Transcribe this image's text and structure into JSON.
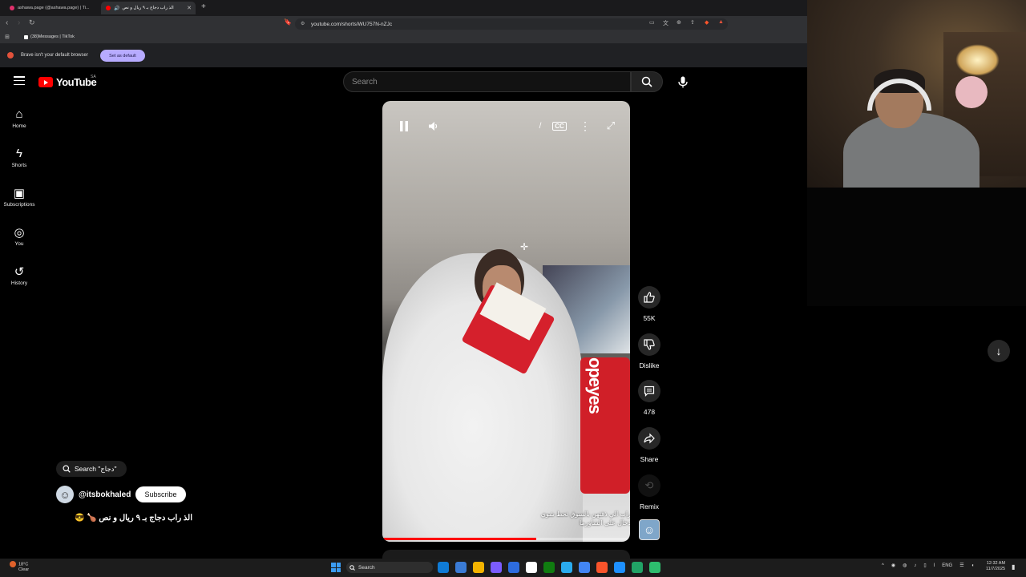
{
  "browser": {
    "tabs": [
      {
        "title": "ashawa.page (@ashawa.page) | Ti...",
        "active": false,
        "favicon_color": "#e1306c"
      },
      {
        "title": "الذ راب دجاج بـ ٩ ريال و نص",
        "active": true,
        "favicon_color": "#ff0000"
      }
    ],
    "new_tab_icon": "+",
    "url": "youtube.com/shorts/WU757N-nZJc",
    "bookmark": "(38)Messages | TikTok",
    "infobar": {
      "message": "Brave isn't your default browser",
      "button": "Set as default"
    }
  },
  "youtube": {
    "logo_text": "YouTube",
    "country": "SA",
    "search_placeholder": "Search",
    "sidebar": [
      {
        "label": "Home",
        "icon": "home-icon"
      },
      {
        "label": "Shorts",
        "icon": "shorts-icon"
      },
      {
        "label": "Subscriptions",
        "icon": "subscriptions-icon"
      },
      {
        "label": "You",
        "icon": "you-icon"
      },
      {
        "label": "History",
        "icon": "history-icon"
      }
    ],
    "video": {
      "caption_line1": "راب الي ذقتهن بالسوق تحط شوي",
      "caption_line2": "دخال على الشاورما",
      "cup_text": "opeyes",
      "progress": 0.62
    },
    "actions": {
      "like_count": "55K",
      "dislike_label": "Dislike",
      "comment_count": "478",
      "share_label": "Share",
      "remix_label": "Remix"
    },
    "search_chip": "Search \"دجاج\"",
    "channel": {
      "handle": "@itsbokhaled",
      "subscribe_label": "Subscribe"
    },
    "short_title": "الذ راب دجاج بـ ٩ ريال و نص 🍗 😎"
  },
  "taskbar": {
    "weather_temp": "18°C",
    "weather_desc": "Clear",
    "search_label": "Search",
    "language": "ENG",
    "time": "12:32 AM",
    "date": "11/7/2025",
    "app_colors": [
      "#0f7bd6",
      "#3a7bd5",
      "#f4b400",
      "#7b5cff",
      "#2d6cdf",
      "#ffffff",
      "#107c10",
      "#2aabee",
      "#4285f4",
      "#fb542b",
      "#1e90ff",
      "#21a366",
      "#2dbd6e"
    ]
  }
}
